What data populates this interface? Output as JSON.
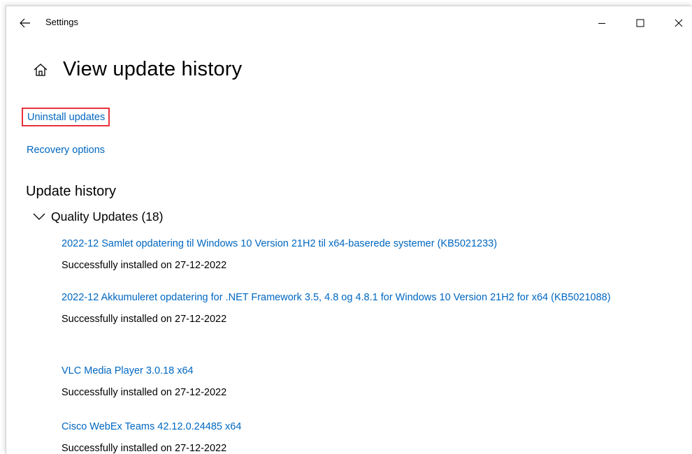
{
  "titlebar": {
    "app_title": "Settings",
    "back_icon": "arrow-left-icon",
    "minimize_icon": "minimize-icon",
    "maximize_icon": "maximize-icon",
    "close_icon": "close-icon"
  },
  "page": {
    "home_icon": "home-icon",
    "title": "View update history"
  },
  "links": {
    "uninstall": "Uninstall updates",
    "recovery": "Recovery options"
  },
  "history": {
    "section_title": "Update history",
    "group_label": "Quality Updates (18)",
    "items": [
      {
        "name": "2022-12 Samlet opdatering til Windows 10 Version 21H2 til x64-baserede systemer (KB5021233)",
        "status": "Successfully installed on 27-12-2022"
      },
      {
        "name": "2022-12 Akkumuleret opdatering for .NET Framework 3.5, 4.8 og 4.8.1 for Windows 10 Version 21H2 for x64 (KB5021088)",
        "status": "Successfully installed on 27-12-2022"
      },
      {
        "name": "VLC Media Player 3.0.18 x64",
        "status": "Successfully installed on 27-12-2022"
      },
      {
        "name": "Cisco WebEx Teams 42.12.0.24485 x64",
        "status": "Successfully installed on 27-12-2022"
      }
    ]
  },
  "colors": {
    "link": "#0067c0",
    "highlight_border": "#e8323c",
    "text": "#000000"
  }
}
